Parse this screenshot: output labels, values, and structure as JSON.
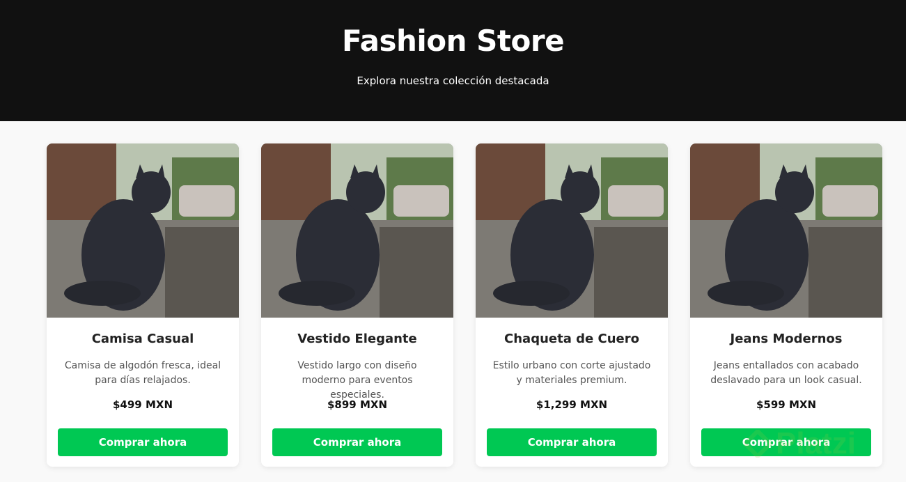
{
  "header": {
    "title": "Fashion Store",
    "subtitle": "Explora nuestra colección destacada"
  },
  "products": [
    {
      "name": "Camisa Casual",
      "description": "Camisa de algodón fresca, ideal para días relajados.",
      "price": "$499 MXN",
      "button_label": "Comprar ahora"
    },
    {
      "name": "Vestido Elegante",
      "description": "Vestido largo con diseño moderno para eventos especiales.",
      "price": "$899 MXN",
      "button_label": "Comprar ahora"
    },
    {
      "name": "Chaqueta de Cuero",
      "description": "Estilo urbano con corte ajustado y materiales premium.",
      "price": "$1,299 MXN",
      "button_label": "Comprar ahora"
    },
    {
      "name": "Jeans Modernos",
      "description": "Jeans entallados con acabado deslavado para un look casual.",
      "price": "$599 MXN",
      "button_label": "Comprar ahora"
    }
  ],
  "watermark": {
    "text": "Platzi"
  },
  "colors": {
    "header_bg": "#111111",
    "button_bg": "#00c853",
    "page_bg": "#f9f9f9"
  }
}
